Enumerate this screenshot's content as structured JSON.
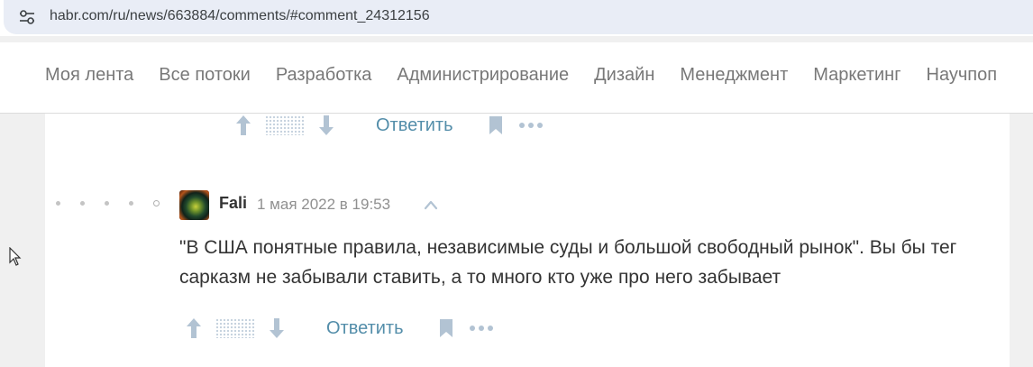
{
  "browser": {
    "url": "habr.com/ru/news/663884/comments/#comment_24312156",
    "site_settings_icon": "tune-icon"
  },
  "nav": {
    "items": [
      "Моя лента",
      "Все потоки",
      "Разработка",
      "Администрирование",
      "Дизайн",
      "Менеджмент",
      "Маркетинг",
      "Научпоп"
    ]
  },
  "prev_comment": {
    "actions": {
      "reply_label": "Ответить",
      "upvote_icon": "arrow-up-icon",
      "downvote_icon": "arrow-down-icon",
      "bookmark_icon": "bookmark-icon",
      "more_icon": "more-icon"
    }
  },
  "comment": {
    "author": "Fali",
    "date": "1 мая 2022 в 19:53",
    "collapse_icon": "chevron-up-icon",
    "text": "\"В США понятные правила, независимые суды и большой свободный рынок\". Вы бы тег сарказм не забывали ставить, а то много кто уже про него забывает",
    "thread_level": 5,
    "actions": {
      "reply_label": "Ответить"
    }
  },
  "colors": {
    "accent_link": "#548eaa",
    "vote_arrows": "#b2c3d3",
    "nav_text": "#787878"
  }
}
